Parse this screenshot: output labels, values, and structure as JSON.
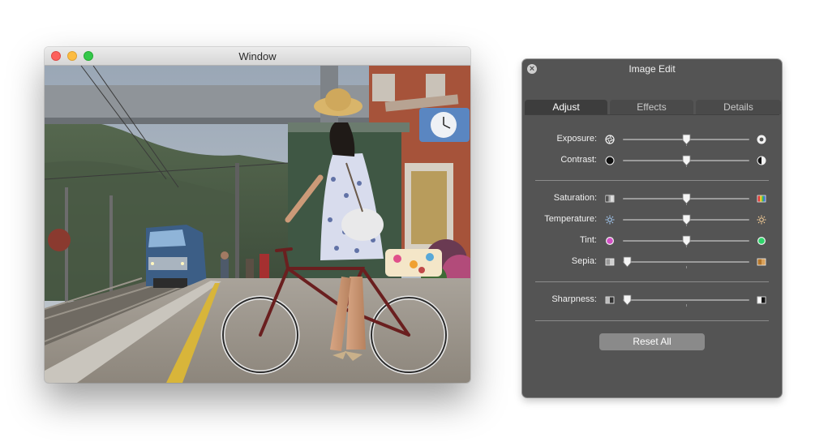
{
  "window": {
    "title": "Window"
  },
  "panel": {
    "title": "Image Edit",
    "tabs": [
      {
        "label": "Adjust",
        "active": true
      },
      {
        "label": "Effects",
        "active": false
      },
      {
        "label": "Details",
        "active": false
      }
    ],
    "sliders": [
      {
        "label": "Exposure:",
        "value": 0.5,
        "icon_left": "aperture-dark-icon",
        "icon_right": "aperture-light-icon"
      },
      {
        "label": "Contrast:",
        "value": 0.5,
        "icon_left": "black-circle-icon",
        "icon_right": "half-circle-icon"
      },
      {
        "label": "Saturation:",
        "value": 0.5,
        "icon_left": "grayscale-swatch-icon",
        "icon_right": "color-swatch-icon"
      },
      {
        "label": "Temperature:",
        "value": 0.5,
        "icon_left": "cool-sun-icon",
        "icon_right": "warm-sun-icon"
      },
      {
        "label": "Tint:",
        "value": 0.5,
        "icon_left": "magenta-dot-icon",
        "icon_right": "green-dot-icon"
      },
      {
        "label": "Sepia:",
        "value": 0.0,
        "icon_left": "gray-swatch-icon",
        "icon_right": "sepia-swatch-icon"
      },
      {
        "label": "Sharpness:",
        "value": 0.0,
        "icon_left": "soft-swatch-icon",
        "icon_right": "sharp-swatch-icon"
      }
    ],
    "reset_label": "Reset All",
    "colors": {
      "panel_bg": "#545454",
      "accent_magenta": "#d24fc4",
      "accent_green": "#2fd46a",
      "sepia": "#b3762b"
    }
  }
}
